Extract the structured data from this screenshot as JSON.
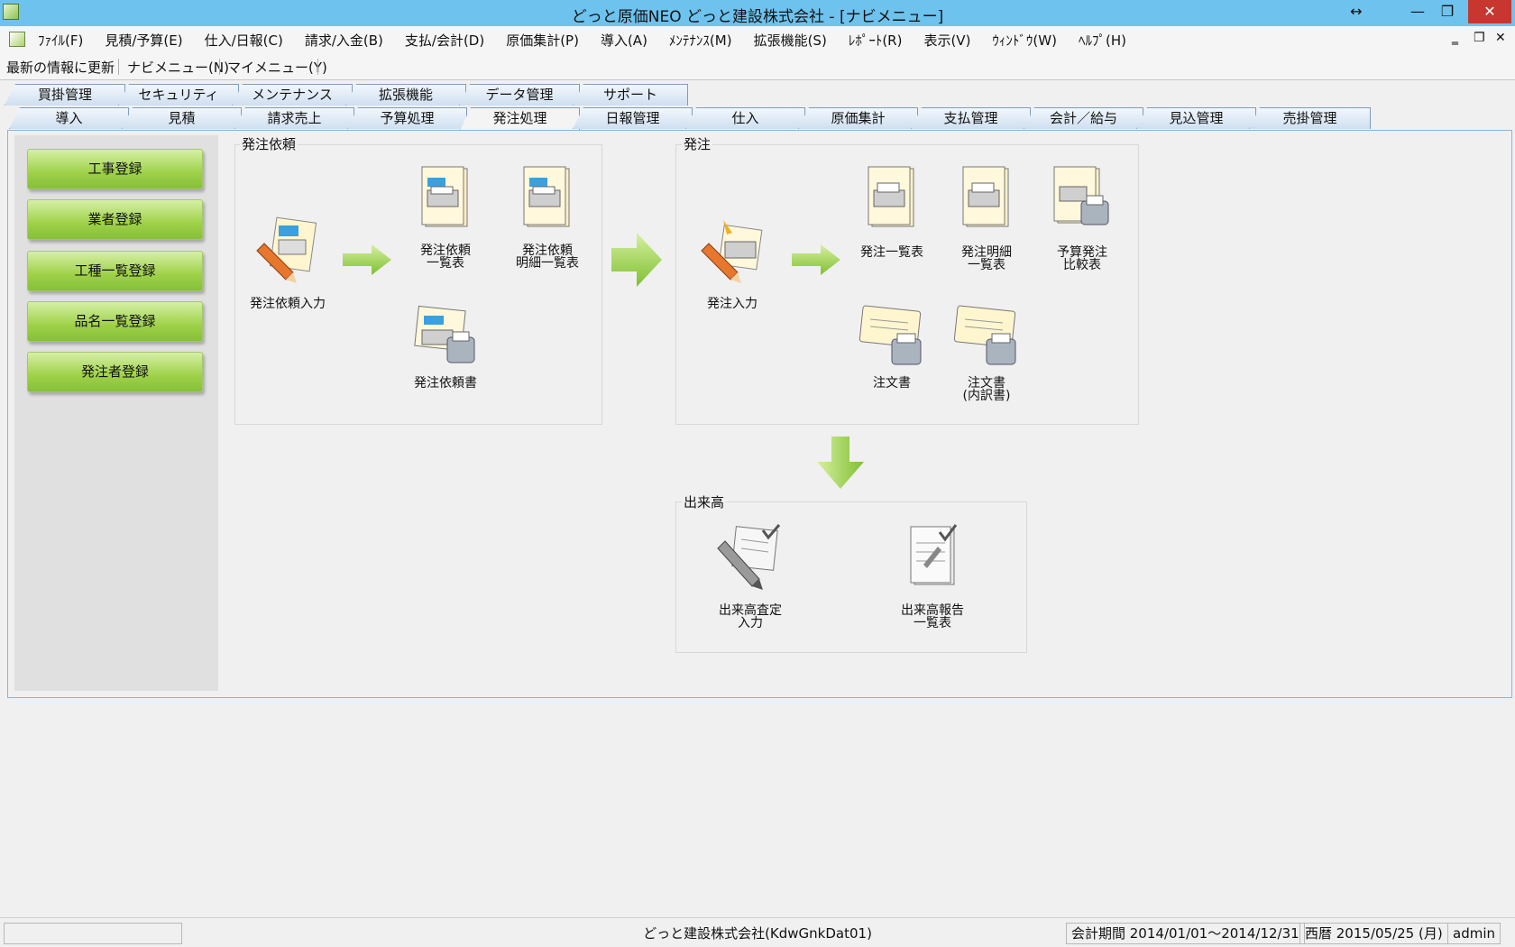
{
  "titlebar": {
    "title": "どっと原価NEO どっと建設株式会社 - [ナビメニュー]",
    "resize_glyph": "↔",
    "minimize_glyph": "—",
    "maximize_glyph": "❐",
    "close_glyph": "✕"
  },
  "menubar": {
    "items": [
      "ﾌｧｲﾙ(F)",
      "見積/予算(E)",
      "仕入/日報(C)",
      "請求/入金(B)",
      "支払/会計(D)",
      "原価集計(P)",
      "導入(A)",
      "ﾒﾝﾃﾅﾝｽ(M)",
      "拡張機能(S)",
      "ﾚﾎﾟｰﾄ(R)",
      "表示(V)",
      "ｳｨﾝﾄﾞｳ(W)",
      "ﾍﾙﾌﾟ(H)"
    ],
    "mdi_min": "‗",
    "mdi_restore": "❐",
    "mdi_close": "✕"
  },
  "toolbar": {
    "refresh": "最新の情報に更新",
    "navi": "ナビメニュー(N)",
    "mymenu": "マイメニュー(Y)"
  },
  "tabs_back": [
    "買掛管理",
    "セキュリティ",
    "メンテナンス",
    "拡張機能",
    "データ管理",
    "サポート"
  ],
  "tabs_front": [
    "導入",
    "見積",
    "請求売上",
    "予算処理",
    "発注処理",
    "日報管理",
    "仕入",
    "原価集計",
    "支払管理",
    "会計／給与",
    "見込管理",
    "売掛管理"
  ],
  "active_tab": "発注処理",
  "left_buttons": [
    "工事登録",
    "業者登録",
    "工種一覧登録",
    "品名一覧登録",
    "発注者登録"
  ],
  "groups": {
    "irai": {
      "title": "発注依頼",
      "items": {
        "input": "発注依頼入力",
        "list": "発注依頼\n一覧表",
        "detail": "発注依頼\n明細一覧表",
        "doc": "発注依頼書"
      }
    },
    "hacchu": {
      "title": "発注",
      "items": {
        "input": "発注入力",
        "list": "発注一覧表",
        "detail": "発注明細\n一覧表",
        "compare": "予算発注\n比較表",
        "order": "注文書",
        "order_detail": "注文書\n(内訳書)"
      }
    },
    "dekidaka": {
      "title": "出来高",
      "items": {
        "input": "出来高査定\n入力",
        "report": "出来高報告\n一覧表"
      }
    }
  },
  "statusbar": {
    "company": "どっと建設株式会社(KdwGnkDat01)",
    "period": "会計期間 2014/01/01～2014/12/31",
    "date": "西暦 2015/05/25 (月)",
    "user": "admin"
  },
  "colors": {
    "titlebar": "#6ec2ee",
    "green_button": "#9ed148",
    "arrow_green": "#8cc63f",
    "tab_border": "#7f9db9"
  }
}
